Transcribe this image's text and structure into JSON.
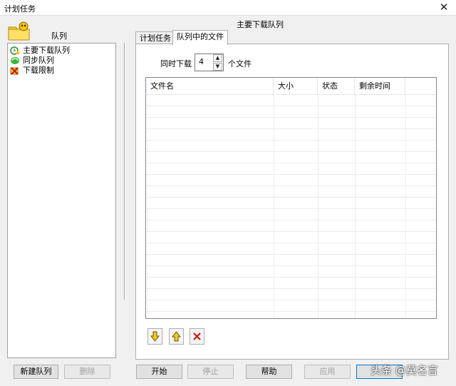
{
  "window": {
    "title": "计划任务",
    "close_glyph": "✕"
  },
  "left_panel": {
    "label": "队列",
    "items": [
      {
        "label": "主要下载队列",
        "icon": "main-queue-icon"
      },
      {
        "label": "同步队列",
        "icon": "sync-queue-icon"
      },
      {
        "label": "下载限制",
        "icon": "download-limit-icon"
      }
    ],
    "new_button": "新建队列",
    "delete_button": "删除"
  },
  "right_panel": {
    "queue_title": "主要下载队列",
    "tabs": [
      {
        "label": "计划任务",
        "active": false
      },
      {
        "label": "队列中的文件",
        "active": true
      }
    ],
    "simultaneous": {
      "label": "同时下载",
      "value": "4",
      "unit": "个文件"
    },
    "columns": [
      "文件名",
      "大小",
      "状态",
      "剩余时间"
    ],
    "rows": []
  },
  "footer": {
    "start": "开始",
    "stop": "停止",
    "help": "帮助",
    "apply": "应用",
    "watermark": "头条 @莫名言"
  },
  "colors": {
    "accent": "#0078d7",
    "delete_red": "#d01010",
    "arrow_yellow": "#f3c91f"
  }
}
